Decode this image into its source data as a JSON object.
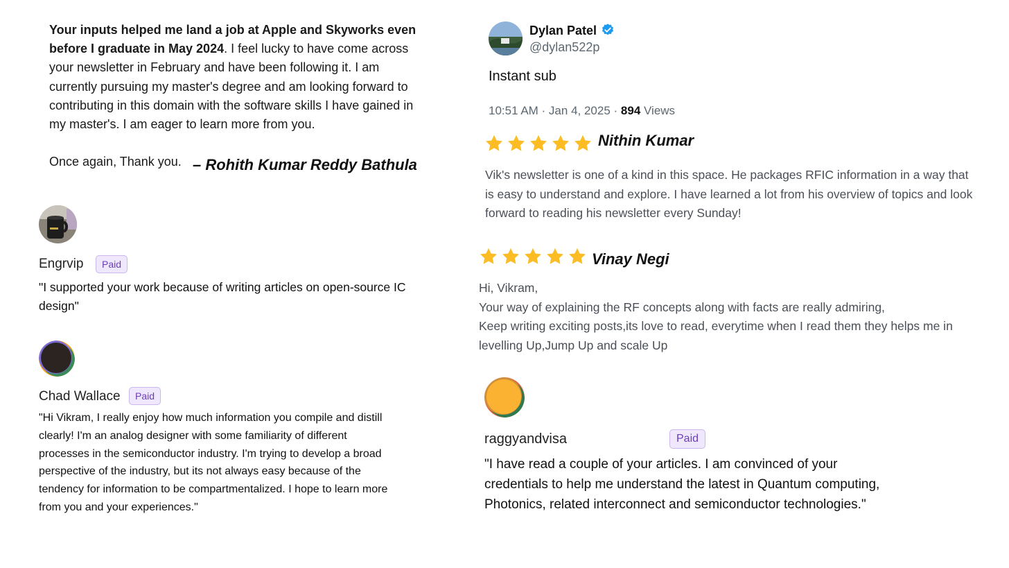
{
  "rohith": {
    "bold_lead": "Your inputs helped me land a job at Apple and Skyworks even before I graduate in May 2024",
    "body": ". I feel lucky to have come across your newsletter in February and have been following it. I am currently pursuing my master's degree and am looking forward to contributing in this domain with the software skills I have gained in my master's. I am eager to learn more from you.",
    "closing": "Once again, Thank you.",
    "signature": "– Rohith Kumar Reddy Bathula"
  },
  "engrvip": {
    "name": "Engrvip",
    "badge": "Paid",
    "quote": "\"I supported your work because of writing articles on open-source IC design\""
  },
  "chad": {
    "name": "Chad Wallace",
    "badge": "Paid",
    "quote": "\"Hi Vikram, I really enjoy how much information you compile and distill clearly! I'm an analog designer with some familiarity of different processes in the semiconductor industry. I'm trying to develop a broad perspective of the industry, but its not always easy because of the tendency for information to be compartmentalized. I hope to learn more from you and your experiences.\""
  },
  "tweet": {
    "name": "Dylan Patel",
    "handle": "@dylan522p",
    "text": "Instant sub",
    "time": "10:51 AM · Jan 4, 2025 · ",
    "views_count": "894",
    "views_label": " Views",
    "verified_color": "#1d9bf0"
  },
  "nithin": {
    "reviewer": "Nithin Kumar",
    "stars": 5,
    "review": "Vik's newsletter is one of a kind in this space. He packages RFIC information in a way that is easy to understand and explore. I have learned a lot from his overview of topics and look forward to reading his newsletter every Sunday!"
  },
  "vinay": {
    "reviewer": "Vinay Negi",
    "stars": 5,
    "line1": "Hi, Vikram,",
    "line2": "Your way of explaining the RF concepts along with facts are really admiring,",
    "line3": "Keep writing exciting posts,its love to read, everytime when I read them they helps me in levelling Up,Jump Up and scale Up"
  },
  "raggy": {
    "name": "raggyandvisa",
    "badge": "Paid",
    "quote": "\"I have read a couple of your articles. I am convinced of your credentials to help me understand the latest in Quantum computing, Photonics, related interconnect and semiconductor technologies.\""
  },
  "colors": {
    "star": "#fbbc24",
    "badge_bg": "#efe7fc",
    "badge_text": "#6b3fb5"
  }
}
